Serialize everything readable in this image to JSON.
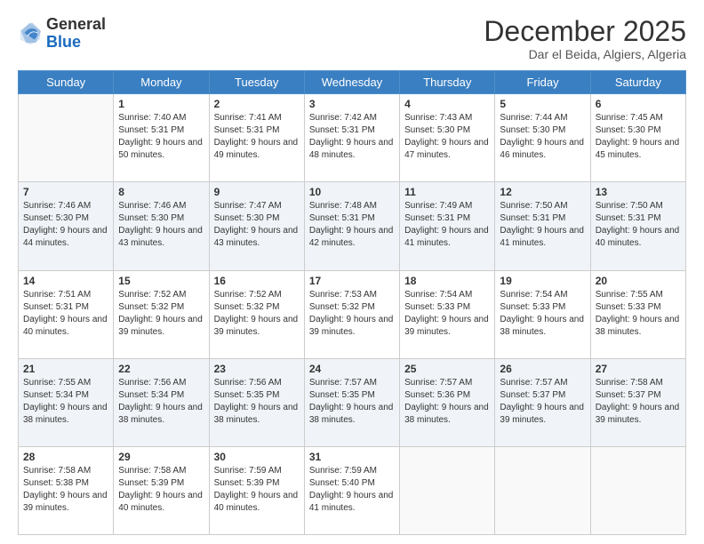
{
  "logo": {
    "text_general": "General",
    "text_blue": "Blue"
  },
  "header": {
    "month": "December 2025",
    "location": "Dar el Beida, Algiers, Algeria"
  },
  "weekdays": [
    "Sunday",
    "Monday",
    "Tuesday",
    "Wednesday",
    "Thursday",
    "Friday",
    "Saturday"
  ],
  "weeks": [
    [
      {
        "day": "",
        "sunrise": "",
        "sunset": "",
        "daylight": ""
      },
      {
        "day": "1",
        "sunrise": "Sunrise: 7:40 AM",
        "sunset": "Sunset: 5:31 PM",
        "daylight": "Daylight: 9 hours and 50 minutes."
      },
      {
        "day": "2",
        "sunrise": "Sunrise: 7:41 AM",
        "sunset": "Sunset: 5:31 PM",
        "daylight": "Daylight: 9 hours and 49 minutes."
      },
      {
        "day": "3",
        "sunrise": "Sunrise: 7:42 AM",
        "sunset": "Sunset: 5:31 PM",
        "daylight": "Daylight: 9 hours and 48 minutes."
      },
      {
        "day": "4",
        "sunrise": "Sunrise: 7:43 AM",
        "sunset": "Sunset: 5:30 PM",
        "daylight": "Daylight: 9 hours and 47 minutes."
      },
      {
        "day": "5",
        "sunrise": "Sunrise: 7:44 AM",
        "sunset": "Sunset: 5:30 PM",
        "daylight": "Daylight: 9 hours and 46 minutes."
      },
      {
        "day": "6",
        "sunrise": "Sunrise: 7:45 AM",
        "sunset": "Sunset: 5:30 PM",
        "daylight": "Daylight: 9 hours and 45 minutes."
      }
    ],
    [
      {
        "day": "7",
        "sunrise": "Sunrise: 7:46 AM",
        "sunset": "Sunset: 5:30 PM",
        "daylight": "Daylight: 9 hours and 44 minutes."
      },
      {
        "day": "8",
        "sunrise": "Sunrise: 7:46 AM",
        "sunset": "Sunset: 5:30 PM",
        "daylight": "Daylight: 9 hours and 43 minutes."
      },
      {
        "day": "9",
        "sunrise": "Sunrise: 7:47 AM",
        "sunset": "Sunset: 5:30 PM",
        "daylight": "Daylight: 9 hours and 43 minutes."
      },
      {
        "day": "10",
        "sunrise": "Sunrise: 7:48 AM",
        "sunset": "Sunset: 5:31 PM",
        "daylight": "Daylight: 9 hours and 42 minutes."
      },
      {
        "day": "11",
        "sunrise": "Sunrise: 7:49 AM",
        "sunset": "Sunset: 5:31 PM",
        "daylight": "Daylight: 9 hours and 41 minutes."
      },
      {
        "day": "12",
        "sunrise": "Sunrise: 7:50 AM",
        "sunset": "Sunset: 5:31 PM",
        "daylight": "Daylight: 9 hours and 41 minutes."
      },
      {
        "day": "13",
        "sunrise": "Sunrise: 7:50 AM",
        "sunset": "Sunset: 5:31 PM",
        "daylight": "Daylight: 9 hours and 40 minutes."
      }
    ],
    [
      {
        "day": "14",
        "sunrise": "Sunrise: 7:51 AM",
        "sunset": "Sunset: 5:31 PM",
        "daylight": "Daylight: 9 hours and 40 minutes."
      },
      {
        "day": "15",
        "sunrise": "Sunrise: 7:52 AM",
        "sunset": "Sunset: 5:32 PM",
        "daylight": "Daylight: 9 hours and 39 minutes."
      },
      {
        "day": "16",
        "sunrise": "Sunrise: 7:52 AM",
        "sunset": "Sunset: 5:32 PM",
        "daylight": "Daylight: 9 hours and 39 minutes."
      },
      {
        "day": "17",
        "sunrise": "Sunrise: 7:53 AM",
        "sunset": "Sunset: 5:32 PM",
        "daylight": "Daylight: 9 hours and 39 minutes."
      },
      {
        "day": "18",
        "sunrise": "Sunrise: 7:54 AM",
        "sunset": "Sunset: 5:33 PM",
        "daylight": "Daylight: 9 hours and 39 minutes."
      },
      {
        "day": "19",
        "sunrise": "Sunrise: 7:54 AM",
        "sunset": "Sunset: 5:33 PM",
        "daylight": "Daylight: 9 hours and 38 minutes."
      },
      {
        "day": "20",
        "sunrise": "Sunrise: 7:55 AM",
        "sunset": "Sunset: 5:33 PM",
        "daylight": "Daylight: 9 hours and 38 minutes."
      }
    ],
    [
      {
        "day": "21",
        "sunrise": "Sunrise: 7:55 AM",
        "sunset": "Sunset: 5:34 PM",
        "daylight": "Daylight: 9 hours and 38 minutes."
      },
      {
        "day": "22",
        "sunrise": "Sunrise: 7:56 AM",
        "sunset": "Sunset: 5:34 PM",
        "daylight": "Daylight: 9 hours and 38 minutes."
      },
      {
        "day": "23",
        "sunrise": "Sunrise: 7:56 AM",
        "sunset": "Sunset: 5:35 PM",
        "daylight": "Daylight: 9 hours and 38 minutes."
      },
      {
        "day": "24",
        "sunrise": "Sunrise: 7:57 AM",
        "sunset": "Sunset: 5:35 PM",
        "daylight": "Daylight: 9 hours and 38 minutes."
      },
      {
        "day": "25",
        "sunrise": "Sunrise: 7:57 AM",
        "sunset": "Sunset: 5:36 PM",
        "daylight": "Daylight: 9 hours and 38 minutes."
      },
      {
        "day": "26",
        "sunrise": "Sunrise: 7:57 AM",
        "sunset": "Sunset: 5:37 PM",
        "daylight": "Daylight: 9 hours and 39 minutes."
      },
      {
        "day": "27",
        "sunrise": "Sunrise: 7:58 AM",
        "sunset": "Sunset: 5:37 PM",
        "daylight": "Daylight: 9 hours and 39 minutes."
      }
    ],
    [
      {
        "day": "28",
        "sunrise": "Sunrise: 7:58 AM",
        "sunset": "Sunset: 5:38 PM",
        "daylight": "Daylight: 9 hours and 39 minutes."
      },
      {
        "day": "29",
        "sunrise": "Sunrise: 7:58 AM",
        "sunset": "Sunset: 5:39 PM",
        "daylight": "Daylight: 9 hours and 40 minutes."
      },
      {
        "day": "30",
        "sunrise": "Sunrise: 7:59 AM",
        "sunset": "Sunset: 5:39 PM",
        "daylight": "Daylight: 9 hours and 40 minutes."
      },
      {
        "day": "31",
        "sunrise": "Sunrise: 7:59 AM",
        "sunset": "Sunset: 5:40 PM",
        "daylight": "Daylight: 9 hours and 41 minutes."
      },
      {
        "day": "",
        "sunrise": "",
        "sunset": "",
        "daylight": ""
      },
      {
        "day": "",
        "sunrise": "",
        "sunset": "",
        "daylight": ""
      },
      {
        "day": "",
        "sunrise": "",
        "sunset": "",
        "daylight": ""
      }
    ]
  ]
}
